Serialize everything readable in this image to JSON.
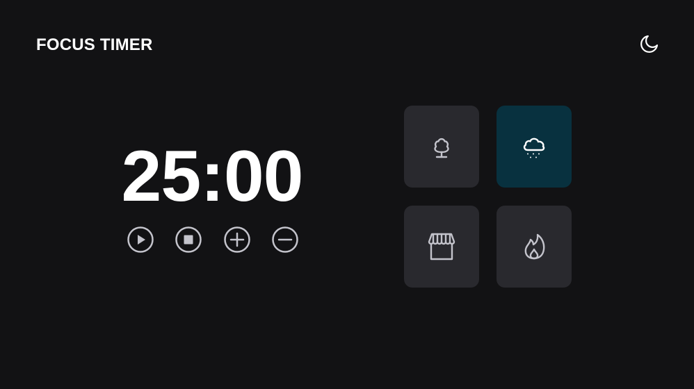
{
  "header": {
    "title": "FOCUS TIMER",
    "theme_toggle_icon": "moon-icon"
  },
  "timer": {
    "display": "25:00"
  },
  "controls": [
    {
      "icon": "play-icon"
    },
    {
      "icon": "stop-icon"
    },
    {
      "icon": "plus-icon"
    },
    {
      "icon": "minus-icon"
    }
  ],
  "sound_cards": [
    {
      "icon": "tree-icon",
      "active": false
    },
    {
      "icon": "cloud-rain-icon",
      "active": true
    },
    {
      "icon": "storefront-icon",
      "active": false
    },
    {
      "icon": "fire-icon",
      "active": false
    }
  ],
  "colors": {
    "background": "#121214",
    "card": "#29292e",
    "card_active": "#08313f",
    "text": "#ffffff",
    "icon": "#c4c4cc"
  }
}
